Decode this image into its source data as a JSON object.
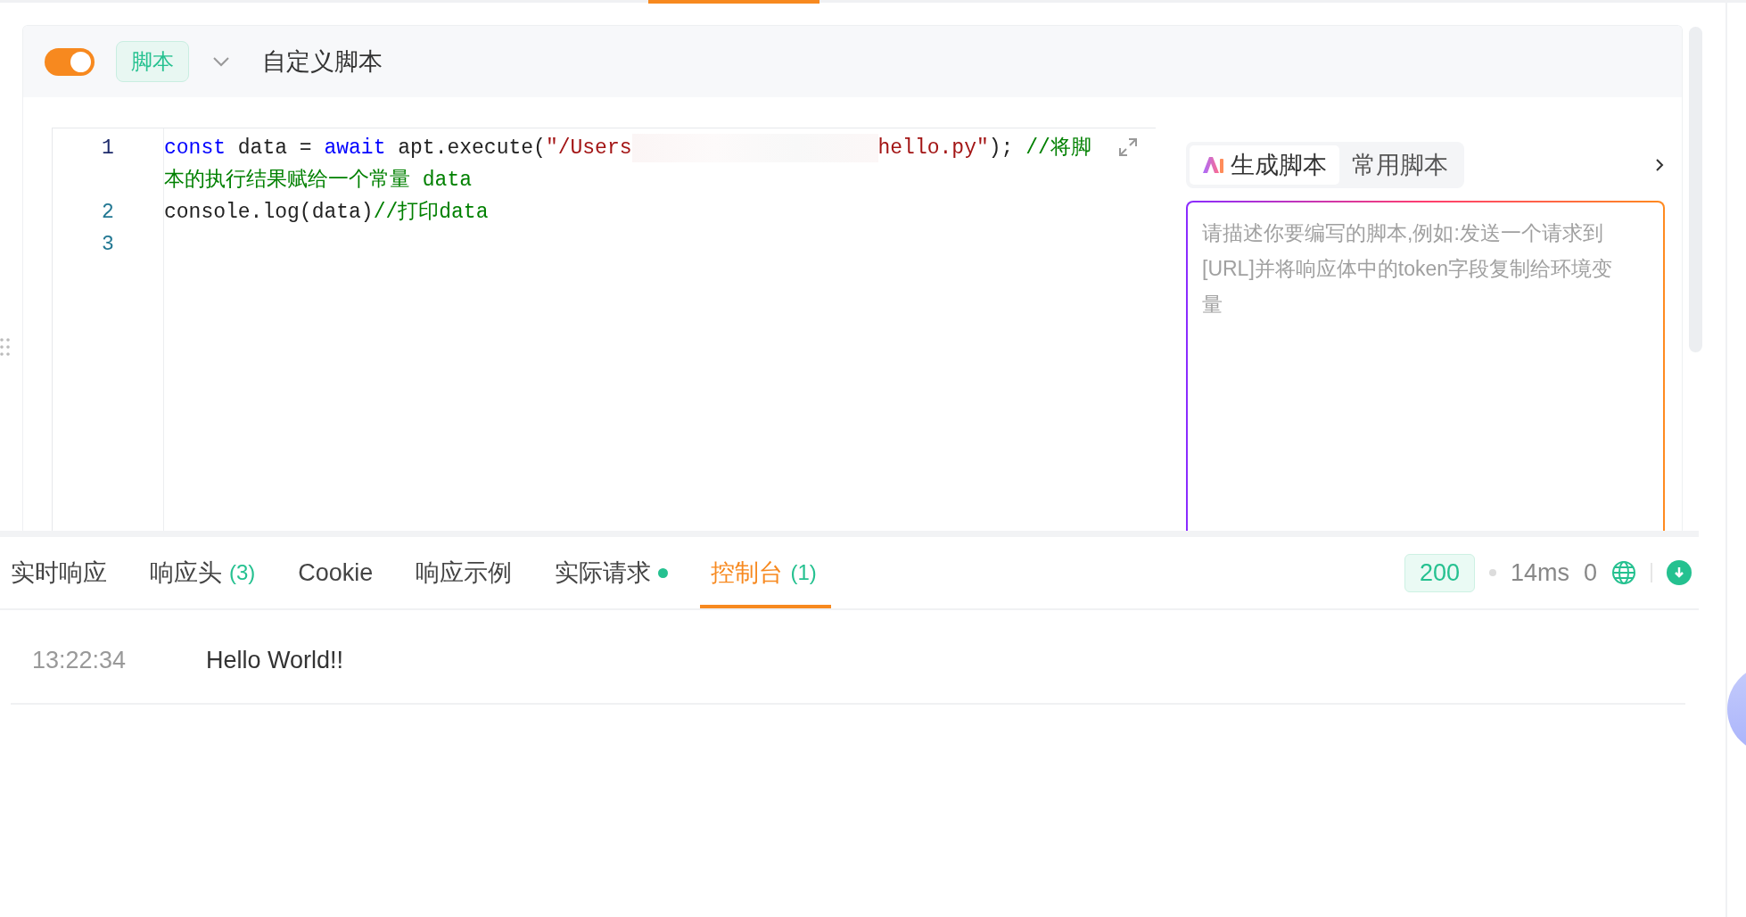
{
  "processor": {
    "enabled": true,
    "tag": "脚本",
    "title": "自定义脚本"
  },
  "editor": {
    "lines": [
      {
        "number": "1",
        "current": true,
        "rows": [
          [
            {
              "kind": "keyword",
              "text": "const"
            },
            {
              "kind": "plain",
              "text": " data = "
            },
            {
              "kind": "keyword",
              "text": "await"
            },
            {
              "kind": "plain",
              "text": " apt.execute("
            },
            {
              "kind": "string",
              "text": "\"/Users"
            },
            {
              "kind": "redacted"
            },
            {
              "kind": "string",
              "text": "hello.py\""
            },
            {
              "kind": "plain",
              "text": "); "
            },
            {
              "kind": "comment",
              "text": "//将脚"
            }
          ],
          [
            {
              "kind": "comment",
              "text": "本的执行结果赋给一个常量 data"
            }
          ]
        ]
      },
      {
        "number": "2",
        "current": false,
        "rows": [
          [
            {
              "kind": "plain",
              "text": "console.log(data)"
            },
            {
              "kind": "comment",
              "text": "//打印data"
            }
          ]
        ]
      },
      {
        "number": "3",
        "current": false,
        "rows": [
          []
        ]
      }
    ]
  },
  "assistant": {
    "tabs": [
      {
        "label": "生成脚本",
        "selected": true,
        "ai": true
      },
      {
        "label": "常用脚本",
        "selected": false,
        "ai": false
      }
    ],
    "placeholder": "请描述你要编写的脚本,例如:发送一个请求到[URL]并将响应体中的token字段复制给环境变量"
  },
  "response_tabs": [
    {
      "label": "实时响应",
      "dot": false,
      "selected": false
    },
    {
      "label": "响应头",
      "count": "(3)",
      "dot": false,
      "selected": false
    },
    {
      "label": "Cookie",
      "dot": false,
      "selected": false
    },
    {
      "label": "响应示例",
      "dot": false,
      "selected": false
    },
    {
      "label": "实际请求",
      "dot": true,
      "selected": false
    },
    {
      "label": "控制台",
      "count": "(1)",
      "dot": false,
      "selected": true
    }
  ],
  "status": {
    "code": "200",
    "time": "14ms",
    "size": "0"
  },
  "console": [
    {
      "time": "13:22:34",
      "message": "Hello World!!"
    }
  ]
}
